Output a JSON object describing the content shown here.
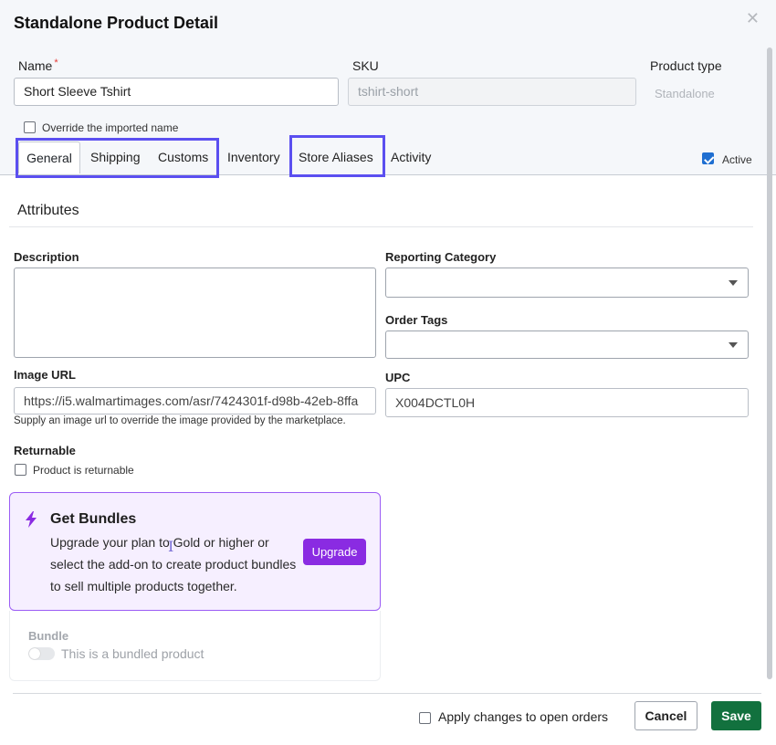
{
  "dialog": {
    "title": "Standalone Product Detail",
    "close_icon": "close-icon"
  },
  "fields": {
    "name": {
      "label": "Name",
      "required_mark": "*",
      "value": "Short Sleeve Tshirt"
    },
    "sku": {
      "label": "SKU",
      "value": "tshirt-short"
    },
    "product_type": {
      "label": "Product type",
      "value": "Standalone"
    },
    "override_label": "Override the imported name"
  },
  "tabs": [
    {
      "label": "General",
      "active": true
    },
    {
      "label": "Shipping"
    },
    {
      "label": "Customs"
    },
    {
      "label": "Inventory"
    },
    {
      "label": "Store Aliases"
    },
    {
      "label": "Activity"
    }
  ],
  "active_toggle": {
    "label": "Active",
    "checked": true
  },
  "attributes": {
    "section_title": "Attributes",
    "description_label": "Description",
    "description_value": "",
    "reporting_category_label": "Reporting Category",
    "order_tags_label": "Order Tags",
    "image_url_label": "Image URL",
    "image_url_value": "https://i5.walmartimages.com/asr/7424301f-d98b-42eb-8ffa",
    "image_url_hint": "Supply an image url to override the image provided by the marketplace.",
    "upc_label": "UPC",
    "upc_value": "X004DCTL0H",
    "returnable_label": "Returnable",
    "returnable_checkbox_label": "Product is returnable"
  },
  "promo": {
    "title": "Get Bundles",
    "text": "Upgrade your plan to Gold or higher or select the add-on to create product bundles to sell multiple products together.",
    "button_label": "Upgrade",
    "icon": "lightning-bolt-icon"
  },
  "bundle": {
    "label": "Bundle",
    "toggle_label": "This is a bundled product"
  },
  "footer": {
    "apply_label": "Apply changes to open orders",
    "cancel_label": "Cancel",
    "save_label": "Save"
  },
  "colors": {
    "highlight_border": "#5b4ff0",
    "upgrade_button": "#8a2be2",
    "save_button": "#12713e",
    "checkbox_checked": "#1f6fd1"
  }
}
